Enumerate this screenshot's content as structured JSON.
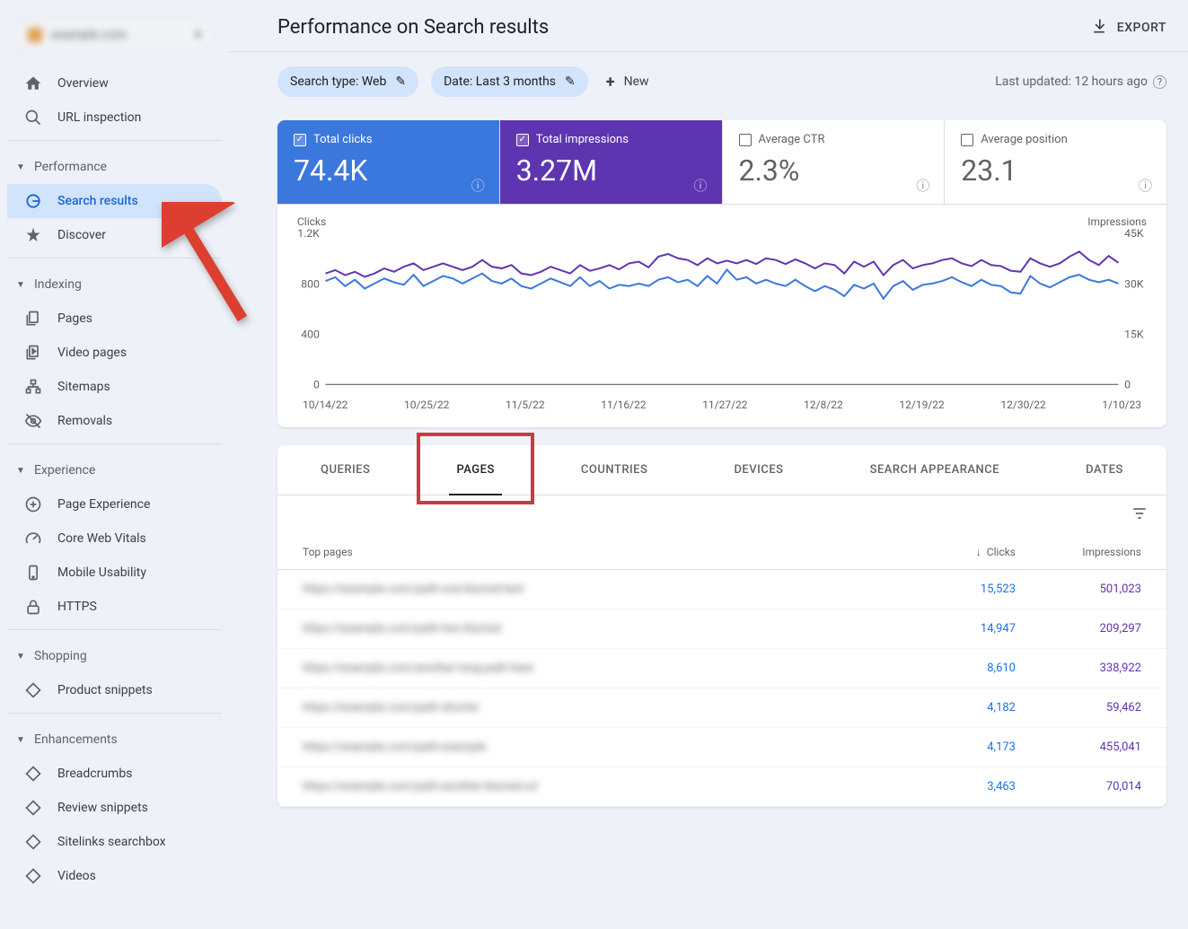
{
  "site_selector": {
    "domain": "example.com"
  },
  "sidebar": {
    "overview": "Overview",
    "url_inspection": "URL inspection",
    "section_performance": "Performance",
    "search_results": "Search results",
    "discover": "Discover",
    "section_indexing": "Indexing",
    "pages": "Pages",
    "video_pages": "Video pages",
    "sitemaps": "Sitemaps",
    "removals": "Removals",
    "section_experience": "Experience",
    "page_experience": "Page Experience",
    "core_web_vitals": "Core Web Vitals",
    "mobile_usability": "Mobile Usability",
    "https": "HTTPS",
    "section_shopping": "Shopping",
    "product_snippets": "Product snippets",
    "section_enhancements": "Enhancements",
    "breadcrumbs": "Breadcrumbs",
    "review_snippets": "Review snippets",
    "sitelinks_searchbox": "Sitelinks searchbox",
    "videos": "Videos"
  },
  "header": {
    "title": "Performance on Search results",
    "export": "EXPORT"
  },
  "filters": {
    "search_type": "Search type: Web",
    "date": "Date: Last 3 months",
    "new": "New",
    "last_updated": "Last updated: 12 hours ago"
  },
  "metrics": {
    "clicks_label": "Total clicks",
    "clicks_value": "74.4K",
    "impressions_label": "Total impressions",
    "impressions_value": "3.27M",
    "ctr_label": "Average CTR",
    "ctr_value": "2.3%",
    "position_label": "Average position",
    "position_value": "23.1"
  },
  "chart_data": {
    "type": "line",
    "left_axis_title": "Clicks",
    "right_axis_title": "Impressions",
    "left_ylim": [
      0,
      1200
    ],
    "right_ylim": [
      0,
      45000
    ],
    "left_ticks": [
      "1.2K",
      "800",
      "400",
      "0"
    ],
    "right_ticks": [
      "45K",
      "30K",
      "15K",
      "0"
    ],
    "x_labels": [
      "10/14/22",
      "10/25/22",
      "11/5/22",
      "11/16/22",
      "11/27/22",
      "12/8/22",
      "12/19/22",
      "12/30/22",
      "1/10/23"
    ],
    "series": [
      {
        "name": "Clicks",
        "color": "#3b78de",
        "values": [
          820,
          850,
          780,
          830,
          760,
          800,
          840,
          810,
          790,
          870,
          780,
          820,
          860,
          840,
          800,
          840,
          880,
          820,
          800,
          840,
          780,
          760,
          800,
          840,
          810,
          780,
          850,
          780,
          820,
          760,
          790,
          780,
          800,
          780,
          830,
          850,
          810,
          830,
          780,
          860,
          800,
          910,
          830,
          850,
          800,
          830,
          800,
          780,
          830,
          780,
          740,
          780,
          750,
          700,
          790,
          760,
          800,
          680,
          780,
          820,
          750,
          790,
          800,
          820,
          850,
          810,
          780,
          830,
          790,
          780,
          730,
          720,
          860,
          800,
          770,
          810,
          850,
          870,
          830,
          810,
          830,
          800
        ]
      },
      {
        "name": "Impressions",
        "color": "#5e35b1",
        "values": [
          33000,
          34000,
          32500,
          33500,
          32000,
          33000,
          34500,
          33500,
          35000,
          36000,
          34000,
          35000,
          36000,
          35000,
          34000,
          35000,
          37000,
          35000,
          34500,
          35500,
          33000,
          32500,
          33500,
          35000,
          34000,
          33000,
          35500,
          33800,
          34500,
          35500,
          34200,
          36000,
          36500,
          34800,
          38000,
          38800,
          37500,
          37000,
          35500,
          37500,
          36000,
          36800,
          36000,
          37000,
          35800,
          37500,
          37000,
          35800,
          37200,
          36000,
          34500,
          36000,
          35500,
          33000,
          36500,
          35000,
          36500,
          32500,
          35500,
          37000,
          34500,
          35500,
          36000,
          37000,
          37500,
          36000,
          35200,
          37000,
          35500,
          35200,
          33800,
          33500,
          37500,
          36000,
          35000,
          36000,
          38000,
          39500,
          37000,
          35500,
          38200,
          36200
        ]
      }
    ]
  },
  "tabs": {
    "queries": "QUERIES",
    "pages": "PAGES",
    "countries": "COUNTRIES",
    "devices": "DEVICES",
    "search_appearance": "SEARCH APPEARANCE",
    "dates": "DATES"
  },
  "table": {
    "col_pages": "Top pages",
    "col_clicks": "Clicks",
    "col_impressions": "Impressions",
    "rows": [
      {
        "page": "https://example.com/path-one-blurred-text",
        "clicks": "15,523",
        "impressions": "501,023"
      },
      {
        "page": "https://example.com/path-two-blurred",
        "clicks": "14,947",
        "impressions": "209,297"
      },
      {
        "page": "https://example.com/another-long-path-here",
        "clicks": "8,610",
        "impressions": "338,922"
      },
      {
        "page": "https://example.com/path-shorter",
        "clicks": "4,182",
        "impressions": "59,462"
      },
      {
        "page": "https://example.com/path-example",
        "clicks": "4,173",
        "impressions": "455,041"
      },
      {
        "page": "https://example.com/path-another-blurred-url",
        "clicks": "3,463",
        "impressions": "70,014"
      }
    ]
  }
}
